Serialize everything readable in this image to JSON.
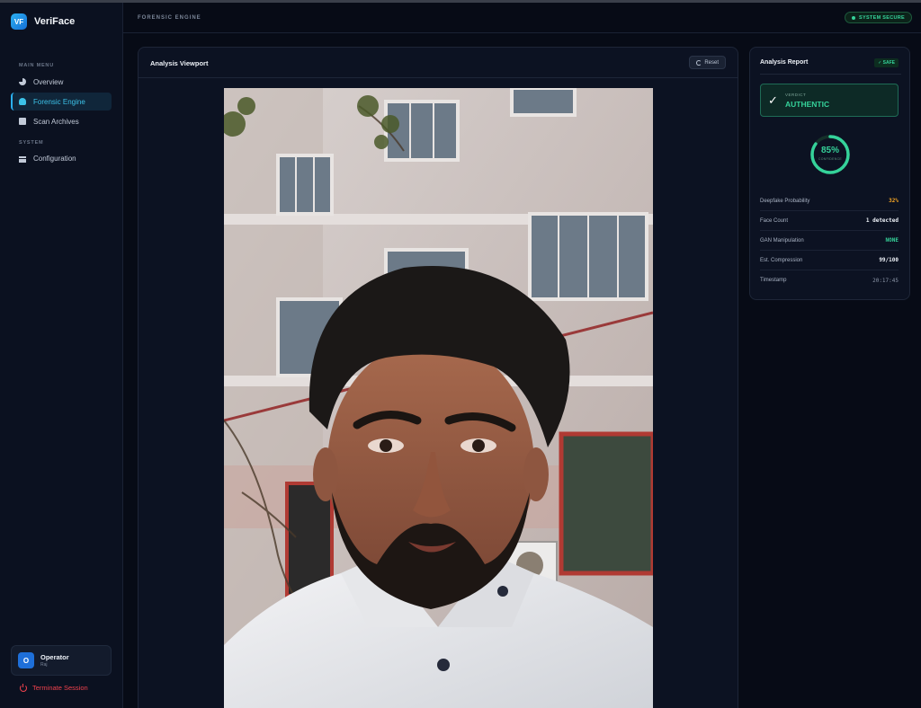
{
  "app": {
    "name": "VeriFace",
    "logo_text": "VF"
  },
  "sidebar": {
    "main_menu_label": "MAIN MENU",
    "system_label": "SYSTEM",
    "items": [
      {
        "label": "Overview",
        "icon": "pie-chart-icon"
      },
      {
        "label": "Forensic Engine",
        "icon": "fingerprint-icon",
        "active": true
      },
      {
        "label": "Scan Archives",
        "icon": "archive-icon"
      },
      {
        "label": "Configuration",
        "icon": "sliders-icon"
      }
    ],
    "operator": {
      "initial": "O",
      "name": "Operator",
      "role": "Raj"
    },
    "terminate_label": "Terminate Session"
  },
  "header": {
    "title": "FORENSIC ENGINE",
    "status": "SYSTEM SECURE",
    "status_color": "#35d29a"
  },
  "viewport": {
    "title": "Analysis Viewport",
    "reset_label": "Reset"
  },
  "report": {
    "title": "Analysis Report",
    "badge": "✓ SAFE",
    "verdict_label": "VERDICT",
    "verdict_value": "AUTHENTIC",
    "confidence": "85%",
    "confidence_fraction": 0.85,
    "confidence_label": "CONFIDENCE",
    "metrics": [
      {
        "label": "Deepfake Probability",
        "value": "32%",
        "tone": "warn"
      },
      {
        "label": "Face Count",
        "value": "1 detected",
        "tone": "normal"
      },
      {
        "label": "GAN Manipulation",
        "value": "NONE",
        "tone": "ok"
      },
      {
        "label": "Est. Compression",
        "value": "99/100",
        "tone": "normal"
      },
      {
        "label": "Timestamp",
        "value": "20:17:45",
        "tone": "dim"
      }
    ]
  },
  "colors": {
    "accent": "#2bb0f0",
    "success": "#35d29a",
    "warning": "#f5a524",
    "danger": "#f0424d"
  }
}
